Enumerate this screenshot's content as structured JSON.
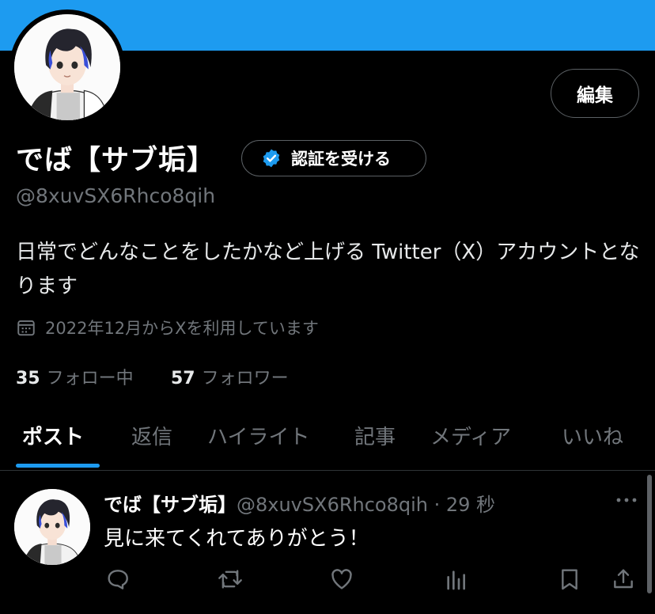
{
  "profile": {
    "display_name": "でば【サブ垢】",
    "handle": "@8xuvSX6Rhco8qih",
    "bio": "日常でどんなことをしたかなど上げる Twitter（X）アカウントとなります",
    "joined": "2022年12月からXを利用しています",
    "following_count": "35",
    "following_label": "フォロー中",
    "followers_count": "57",
    "followers_label": "フォロワー"
  },
  "buttons": {
    "edit": "編集",
    "verify": "認証を受ける"
  },
  "tabs": [
    {
      "label": "ポスト",
      "active": true
    },
    {
      "label": "返信",
      "active": false
    },
    {
      "label": "ハイライト",
      "active": false
    },
    {
      "label": "記事",
      "active": false
    },
    {
      "label": "メディア",
      "active": false
    },
    {
      "label": "いいね",
      "active": false
    }
  ],
  "post": {
    "author": "でば【サブ垢】",
    "meta": "@8xuvSX6Rhco8qih · 29 秒",
    "text": "見に来てくれてありがとう！",
    "actions": [
      "reply-icon",
      "repost-icon",
      "like-icon",
      "views-icon",
      "bookmark-icon",
      "share-icon"
    ]
  },
  "colors": {
    "banner": "#1d9bf0",
    "background": "#000000",
    "accent": "#1d9bf0",
    "secondary_text": "#71767b"
  }
}
